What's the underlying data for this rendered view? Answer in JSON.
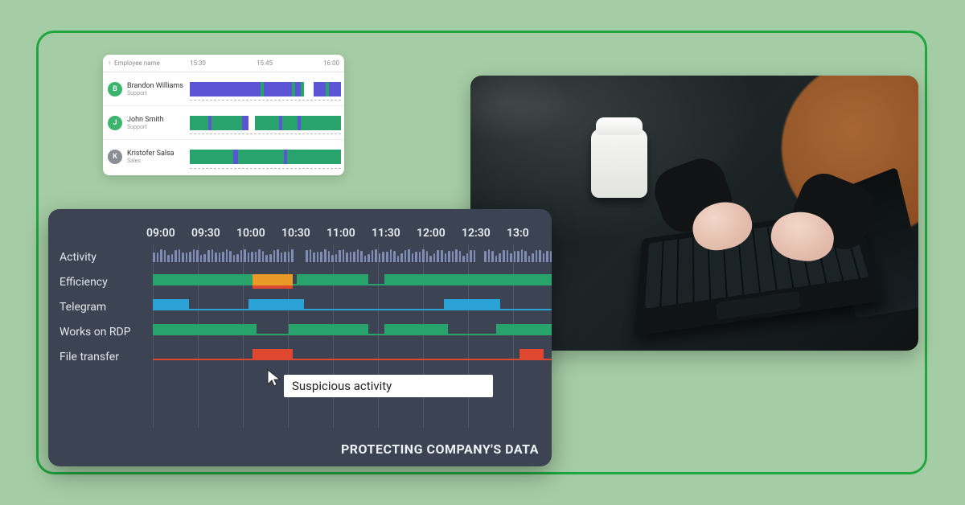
{
  "mini": {
    "header_label": "Employee name",
    "times": [
      "15:30",
      "15:45",
      "16:00"
    ],
    "rows": [
      {
        "initial": "B",
        "color": "#3db46d",
        "name": "Brandon Williams",
        "role": "Support"
      },
      {
        "initial": "J",
        "color": "#3db46d",
        "name": "John Smith",
        "role": "Support"
      },
      {
        "initial": "K",
        "color": "#8a8f95",
        "name": "Kristofer Salsa",
        "role": "Sales"
      }
    ]
  },
  "dark": {
    "times": [
      "09:00",
      "09:30",
      "10:00",
      "10:30",
      "11:00",
      "11:30",
      "12:00",
      "12:30",
      "13:0"
    ],
    "lanes": [
      "Activity",
      "Efficiency",
      "Telegram",
      "Works on RDP",
      "File transfer"
    ],
    "tooltip": "Suspicious activity",
    "footer": "PROTECTING COMPANY'S DATA"
  },
  "colors": {
    "green": "#29a36c",
    "orange": "#e79a27",
    "red": "#e0472f",
    "blue": "#2aa2d6",
    "purple": "#5b55d6",
    "actbar": "#7f8db6"
  }
}
